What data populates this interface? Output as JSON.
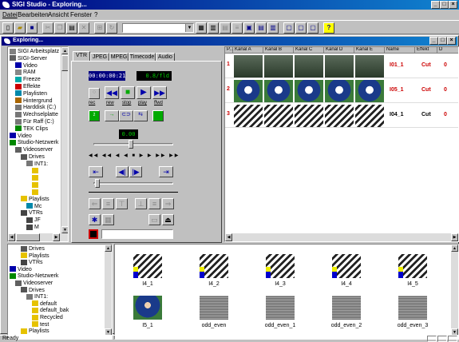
{
  "app": {
    "title": "SIGI Studio - Exploring..."
  },
  "menu": [
    "Datei",
    "Bearbeiten",
    "Ansicht",
    "Fenster",
    "?"
  ],
  "child": {
    "title": "Exploring..."
  },
  "tree_top": [
    {
      "label": "SIGI Arbeitsplatz",
      "icon": "computer-icon",
      "lvl": 0
    },
    {
      "label": "SIGI-Server",
      "icon": "server-icon",
      "lvl": 0
    },
    {
      "label": "Video",
      "icon": "video-icon",
      "lvl": 1
    },
    {
      "label": "RAM",
      "icon": "ram-icon",
      "lvl": 1
    },
    {
      "label": "Freeze",
      "icon": "freeze-icon",
      "lvl": 1
    },
    {
      "label": "Effekte",
      "icon": "effects-icon",
      "lvl": 1
    },
    {
      "label": "Playlisten",
      "icon": "playlist-icon",
      "lvl": 1
    },
    {
      "label": "Hintergrund",
      "icon": "background-icon",
      "lvl": 1
    },
    {
      "label": "Harddisk (C:)",
      "icon": "harddisk-icon",
      "lvl": 1
    },
    {
      "label": "Wechselplatte",
      "icon": "removable-disk-icon",
      "lvl": 1
    },
    {
      "label": "Für Raff (C:)",
      "icon": "drive-icon",
      "lvl": 1
    },
    {
      "label": "TEK Clips",
      "icon": "clips-icon",
      "lvl": 1
    },
    {
      "label": "Video",
      "icon": "video-icon",
      "lvl": 0
    },
    {
      "label": "Studio-Netzwerk",
      "icon": "network-icon",
      "lvl": 0
    },
    {
      "label": "Videoserver",
      "icon": "server-icon",
      "lvl": 1
    },
    {
      "label": "Drives",
      "icon": "drives-icon",
      "lvl": 2
    },
    {
      "label": "INT1:",
      "icon": "drive-icon",
      "lvl": 3
    },
    {
      "label": "",
      "icon": "folder-icon",
      "lvl": 4
    },
    {
      "label": "",
      "icon": "folder-icon",
      "lvl": 4
    },
    {
      "label": "",
      "icon": "folder-icon",
      "lvl": 4
    },
    {
      "label": "",
      "icon": "folder-icon",
      "lvl": 4
    },
    {
      "label": "Playlists",
      "icon": "folder-icon",
      "lvl": 2
    },
    {
      "label": "Mc",
      "icon": "playlist-icon",
      "lvl": 3
    },
    {
      "label": "VTRs",
      "icon": "vtr-icon",
      "lvl": 2
    },
    {
      "label": "JF",
      "icon": "vtr-icon",
      "lvl": 3
    },
    {
      "label": "M",
      "icon": "vtr-icon",
      "lvl": 3
    }
  ],
  "vtr": {
    "tabs": [
      "VTR",
      "JPEG",
      "MPEG",
      "Timecode",
      "Audio"
    ],
    "timecode": "00:00:00:21",
    "rate": "0.8/fld",
    "transport_labels": [
      "rec",
      "rew",
      "stop",
      "play",
      "ffwd"
    ],
    "counter": "0.00"
  },
  "grid": {
    "headers": [
      "P...",
      "Kanal A",
      "Kanal B",
      "Kanal C",
      "Kanal D",
      "Kanal E",
      "Name",
      "Effekt",
      "D"
    ],
    "rows": [
      {
        "num": "1",
        "name": "I01_1",
        "effekt": "Cut",
        "d": "0"
      },
      {
        "num": "2",
        "name": "I05_1",
        "effekt": "Cut",
        "d": "0"
      },
      {
        "num": "3",
        "name": "I04_1",
        "effekt": "Cut",
        "d": "0"
      }
    ]
  },
  "tree_bottom": [
    {
      "label": "Drives",
      "icon": "drives-icon",
      "lvl": 2
    },
    {
      "label": "Playlists",
      "icon": "folder-icon",
      "lvl": 2
    },
    {
      "label": "VTRs",
      "icon": "vtr-icon",
      "lvl": 2
    },
    {
      "label": "Video",
      "icon": "video-icon",
      "lvl": 0
    },
    {
      "label": "Studio-Netzwerk",
      "icon": "network-icon",
      "lvl": 0
    },
    {
      "label": "Videoserver",
      "icon": "server-icon",
      "lvl": 1
    },
    {
      "label": "Drives",
      "icon": "drives-icon",
      "lvl": 2
    },
    {
      "label": "INT1:",
      "icon": "drive-icon",
      "lvl": 3
    },
    {
      "label": "default",
      "icon": "folder-icon",
      "lvl": 4
    },
    {
      "label": "default_bak",
      "icon": "folder-icon",
      "lvl": 4
    },
    {
      "label": "Recycled",
      "icon": "folder-icon",
      "lvl": 4
    },
    {
      "label": "test",
      "icon": "folder-icon",
      "lvl": 4
    },
    {
      "label": "Playlists",
      "icon": "folder-icon",
      "lvl": 2
    }
  ],
  "thumbs": [
    {
      "label": "I4_1",
      "kind": "hatch"
    },
    {
      "label": "I4_2",
      "kind": "hatch"
    },
    {
      "label": "I4_3",
      "kind": "hatch"
    },
    {
      "label": "I4_4",
      "kind": "hatch"
    },
    {
      "label": "I4_5",
      "kind": "hatch"
    },
    {
      "label": "I5_1",
      "kind": "player"
    },
    {
      "label": "odd_even",
      "kind": "stripe"
    },
    {
      "label": "odd_even_1",
      "kind": "stripe"
    },
    {
      "label": "odd_even_2",
      "kind": "stripe"
    },
    {
      "label": "odd_even_3",
      "kind": "stripe"
    }
  ],
  "status": {
    "text": "Ready"
  }
}
